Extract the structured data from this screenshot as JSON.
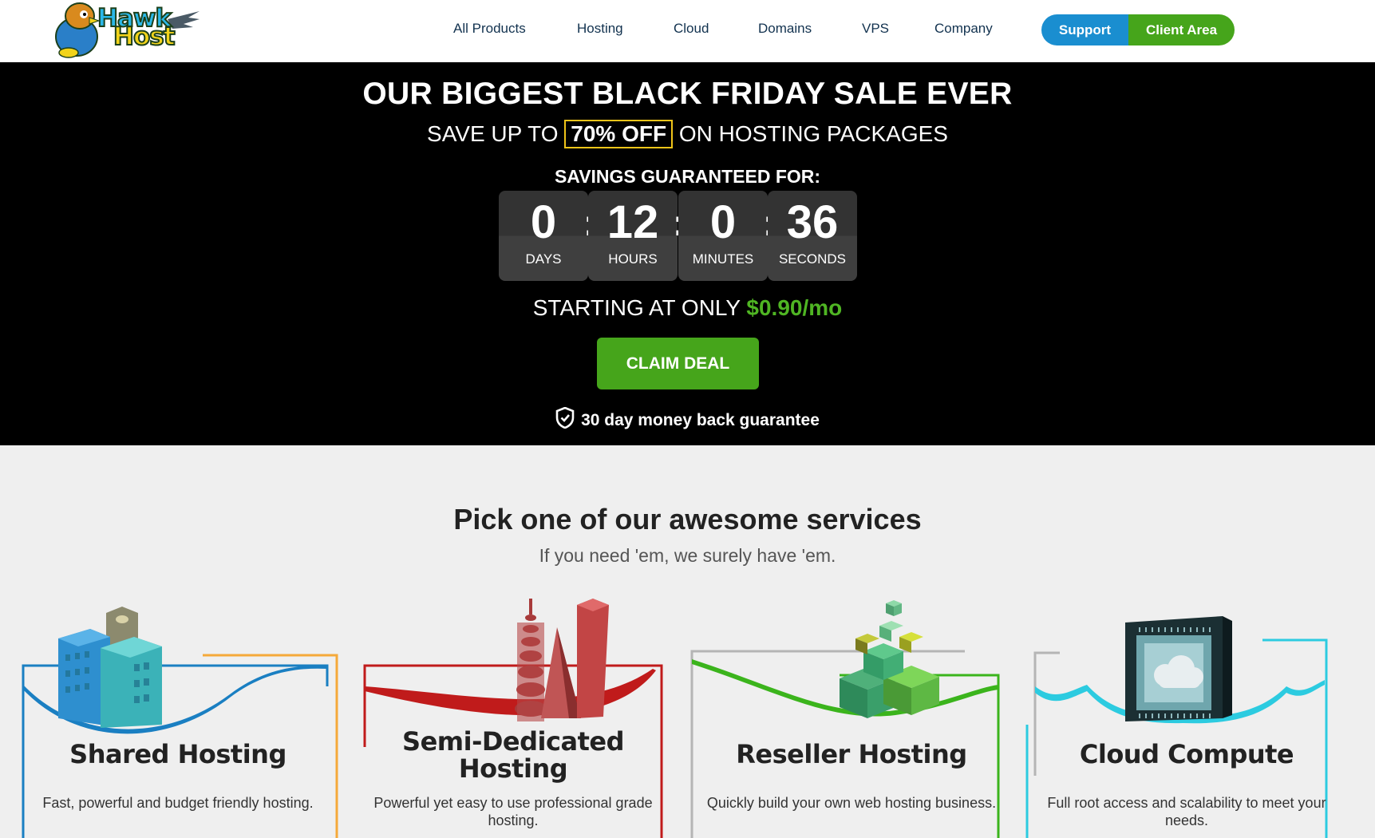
{
  "logo": {
    "line1": "Hawk",
    "line2": "Host"
  },
  "nav": {
    "links": [
      "All Products",
      "Hosting",
      "Cloud",
      "Domains",
      "VPS",
      "Company"
    ],
    "support_label": "Support",
    "client_area_label": "Client Area"
  },
  "hero": {
    "title": "OUR BIGGEST BLACK FRIDAY SALE EVER",
    "sub_prefix": "SAVE UP TO",
    "sub_highlight": "70% OFF",
    "sub_suffix": "ON HOSTING PACKAGES",
    "savings_label": "SAVINGS GUARANTEED FOR:",
    "countdown": [
      {
        "value": "0",
        "label": "DAYS"
      },
      {
        "value": "12",
        "label": "HOURS"
      },
      {
        "value": "0",
        "label": "MINUTES"
      },
      {
        "value": "36",
        "label": "SECONDS"
      }
    ],
    "starting_prefix": "STARTING AT ONLY",
    "starting_price": "$0.90/mo",
    "cta": "CLAIM DEAL",
    "guarantee": "30 day money back guarantee"
  },
  "services": {
    "title": "Pick one of our awesome services",
    "subtitle": "If you need 'em, we surely have 'em.",
    "cards": [
      {
        "title": "Shared Hosting",
        "desc": "Fast, powerful and budget friendly hosting.",
        "accent": "#1a7fc2",
        "accent2": "#f5a93a"
      },
      {
        "title": "Semi-Dedicated Hosting",
        "desc": "Powerful yet easy to use professional grade hosting.",
        "accent": "#c01b1b"
      },
      {
        "title": "Reseller Hosting",
        "desc": "Quickly build your own web hosting business.",
        "accent": "#3bb41c"
      },
      {
        "title": "Cloud Compute",
        "desc": "Full root access and scalability to meet your needs.",
        "accent": "#2ccbe0"
      }
    ]
  },
  "colors": {
    "nav_text": "#12324f",
    "support_blue": "#1a8ed0",
    "brand_green": "#46a51b",
    "price_green": "#4fb523",
    "highlight_border": "#f0c419"
  }
}
